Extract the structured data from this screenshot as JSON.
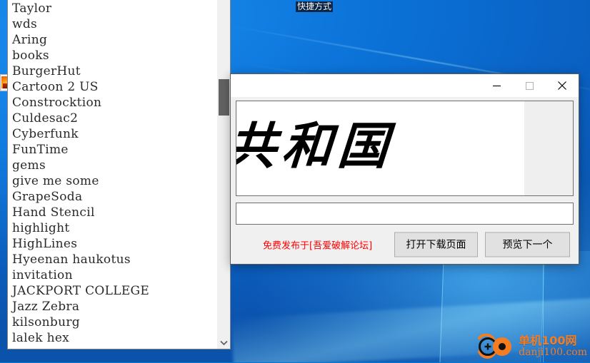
{
  "desktop": {
    "icon_label": "快捷方式",
    "wallpaper_name": "windows10-hero-blue",
    "accent_color": "#0078d7"
  },
  "font_list": {
    "name": "font-family-listbox",
    "items": [
      "Taylor",
      "wds",
      "Aring",
      "books",
      "BurgerHut",
      "Cartoon 2 US",
      "Constrocktion",
      "Culdesac2",
      "Cyberfunk",
      "FunTime",
      "gems",
      "give me some",
      "GrapeSoda",
      "Hand Stencil",
      "highlight",
      "HighLines",
      "Hyeenan haukotus",
      "invitation",
      "JACKPORT COLLEGE",
      "Jazz Zebra",
      "kilsonburg",
      "lalek hex"
    ],
    "scrollbar": {
      "thumb_label": "scroll-thumb",
      "down_arrow_label": "▾"
    }
  },
  "dialog": {
    "title": "",
    "window_controls": {
      "minimize": "—",
      "maximize": "▢",
      "close": "✕"
    },
    "preview": {
      "text": "共和国",
      "background": "#ffffff"
    },
    "input": {
      "value": "",
      "placeholder": ""
    },
    "promo_text": "免费发布于[吾爱破解论坛]",
    "promo_color": "#ff0000",
    "buttons": {
      "open_download": "打开下载页面",
      "preview_next": "预览下一个"
    }
  },
  "watermark": {
    "cn": "单机100网",
    "en": "danji100.com",
    "color": "#f57c20"
  }
}
